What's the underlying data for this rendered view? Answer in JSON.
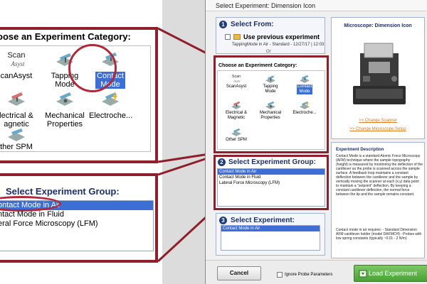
{
  "zoom": {
    "category_title": "oose an Experiment Category:",
    "categories": [
      {
        "label": "Scan\nAsyst",
        "caption": "canAsyst"
      },
      {
        "label": "Tapping\nMode"
      },
      {
        "label": "Contact\nMode",
        "selected": true
      },
      {
        "label": "lectrical &\nagnetic"
      },
      {
        "label": "Mechanical\nProperties"
      },
      {
        "label": "Electroche..."
      },
      {
        "label": "ther SPM"
      }
    ],
    "group_title": "Select Experiment Group:",
    "groups": [
      {
        "label": "ontact Mode in Air",
        "selected": true
      },
      {
        "label": "ntact Mode in Fluid"
      },
      {
        "label": "eral Force Microscopy (LFM)"
      }
    ]
  },
  "dialog": {
    "title": "Select Experiment: Dimension Icon",
    "step1": {
      "number": "1",
      "title": "Select From:",
      "use_previous": "Use previous experiment",
      "previous_info": "TappingMode in Air - Standard - 12/27/17 | 12:03",
      "or": "Or"
    },
    "category_title": "Choose an Experiment Category:",
    "categories": [
      {
        "label": "ScanAsyst",
        "icon_text": "Scan Asyst"
      },
      {
        "label": "Tapping\nMode"
      },
      {
        "label": "Contact\nMode",
        "selected": true
      },
      {
        "label": "Electrical &\nMagnetic"
      },
      {
        "label": "Mechanical\nProperties"
      },
      {
        "label": "Electroche..."
      },
      {
        "label": "Other SPM"
      }
    ],
    "step2": {
      "number": "2",
      "title": "Select Experiment Group:"
    },
    "groups": [
      {
        "label": "Contact Mode in Air",
        "selected": true
      },
      {
        "label": "Contact Mode in Fluid"
      },
      {
        "label": "Lateral Force Microscopy (LFM)"
      }
    ],
    "step3": {
      "number": "3",
      "title": "Select Experiment:"
    },
    "experiments": [
      {
        "label": "Contact Mode in Air",
        "selected": true
      }
    ],
    "microscope": {
      "title": "Microscope: Dimension Icon",
      "change_scanner": ">> Change Scanner",
      "change_setup": ">> Change Microscope Setup"
    },
    "description": {
      "title": "Experiment Description",
      "text": "Contact Mode is a standard Atomic Force Microscopy (AFM) technique where the sample topography (height) is measured by monitoring the deflection of the cantilever as the probe is scanned across the sample surface. A feedback loop maintains a constant deflection between the cantilever and the sample by vertically moving the scanner at each (x,y) data point to maintain a \"setpoint\" deflection. By keeping a constant cantilever deflection, the normal force between the tip and the sample remains constant.",
      "requires": "Contact mode in air requires: - Standard Dimension AFM cantilever holder (model DAFMCH) - Probes with low spring constants (typically ~0.01 - 2 N/m)"
    },
    "cancel": "Cancel",
    "ignore_probe": "Ignore Probe Parameters",
    "load": "Load Experiment"
  },
  "colors": {
    "highlight": "#8e1f2b",
    "selection": "#3b6fd6",
    "heading": "#1d2f6b",
    "link": "#e07a1f",
    "load_button": "#4aa136"
  }
}
